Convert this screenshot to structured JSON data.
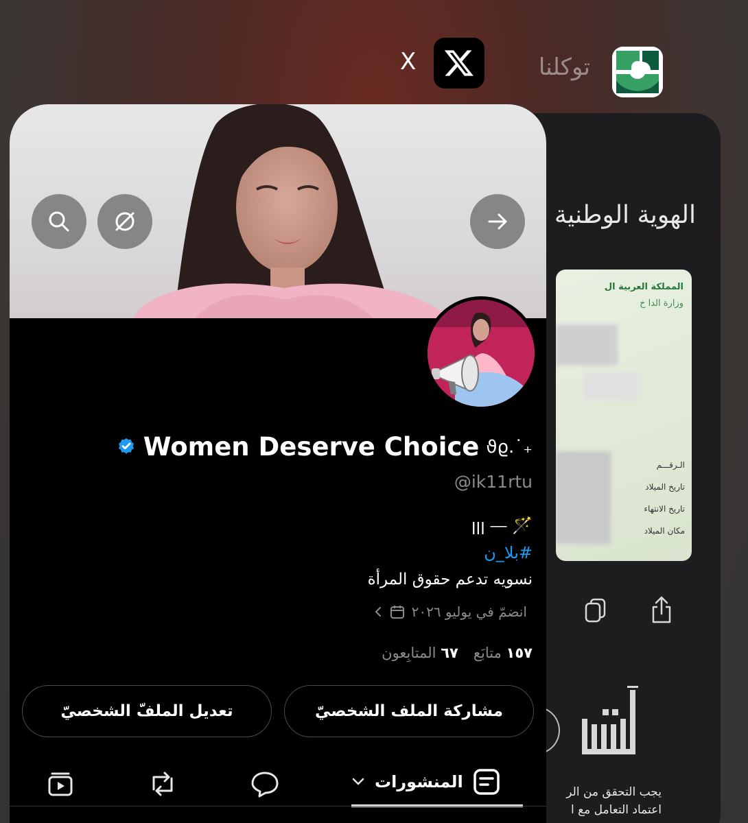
{
  "switcher": {
    "x_app_label": "X",
    "tawakkalna_label": "توكلنا"
  },
  "tawakkalna": {
    "title": "الهوية الوطنية",
    "id_card": {
      "header_line1": "المملكة العربية ال",
      "header_line2": "وزارة الدا خ",
      "field_number": "الـرقـــم",
      "field_birth": "تاريخ الميلاد",
      "field_expiry": "تاريخ الانتهاء",
      "field_birthplace": "مكان الميلاد"
    },
    "absher_note_line1": "يجب التحقق من الر",
    "absher_note_line2": "اعتماد التعامل مع ا"
  },
  "profile": {
    "display_name": "Women Deserve Choice",
    "name_decoration": "ϑϱ.˙₊",
    "handle": "@ik11rtu",
    "bio_line1": "ꞁꞁꞁ ⎯⎯ 🪄",
    "hashtag": "#بلا_ن",
    "bio_text": "نسويه تدعم حقوق المرأة",
    "joined": "انضمّ في يوليو ٢٠٢٦",
    "following_count": "١٥٧",
    "following_label": "متابَع",
    "followers_count": "٦٧",
    "followers_label": "المتابِعون",
    "share_button": "مشاركة الملف الشخصيّ",
    "edit_button": "تعديل الملفّ الشخصيّ",
    "tab_posts": "المنشورات"
  },
  "colors": {
    "accent_blue": "#1d9bf0",
    "verified_blue": "#1d9bf0",
    "absher_green": "#27773b"
  }
}
